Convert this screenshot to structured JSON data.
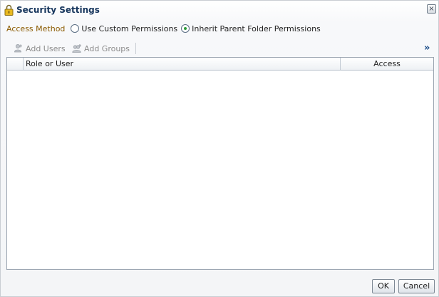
{
  "dialog": {
    "title": "Security Settings",
    "title_icon": "lock-icon",
    "close_glyph": "×"
  },
  "access_method": {
    "label": "Access Method",
    "options": [
      {
        "label": "Use Custom Permissions",
        "selected": false
      },
      {
        "label": "Inherit Parent Folder Permissions",
        "selected": true
      }
    ]
  },
  "toolbar": {
    "add_users_label": "Add Users",
    "add_groups_label": "Add Groups",
    "overflow_glyph": "»"
  },
  "table": {
    "columns": [
      "Role or User",
      "Access"
    ],
    "rows": []
  },
  "footer": {
    "ok_label": "OK",
    "cancel_label": "Cancel"
  },
  "colors": {
    "title": "#17365d",
    "access_label": "#8a5a00",
    "radio_selected": "#2d9b3a",
    "disabled_text": "#8c8c8c"
  }
}
